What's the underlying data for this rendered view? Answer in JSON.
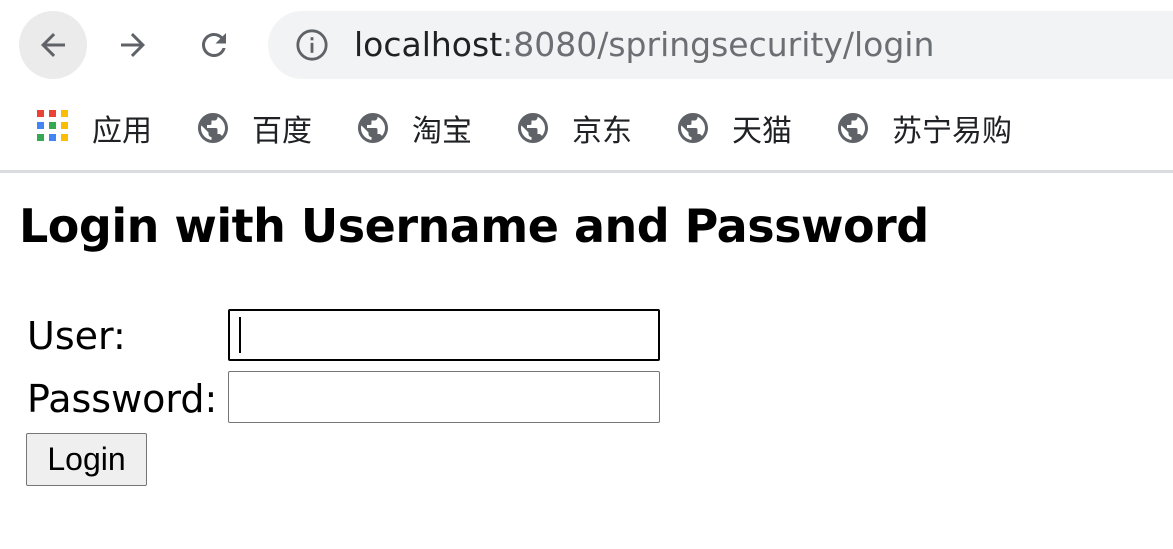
{
  "browser": {
    "url_host": "localhost",
    "url_path": ":8080/springsecurity/login",
    "icons": {
      "back": "arrow-left-icon",
      "forward": "arrow-right-icon",
      "reload": "reload-icon",
      "site_info": "info-icon"
    }
  },
  "bookmarks": [
    {
      "label": "应用",
      "icon": "apps-grid-icon"
    },
    {
      "label": "百度",
      "icon": "globe-icon"
    },
    {
      "label": "淘宝",
      "icon": "globe-icon"
    },
    {
      "label": "京东",
      "icon": "globe-icon"
    },
    {
      "label": "天猫",
      "icon": "globe-icon"
    },
    {
      "label": "苏宁易购",
      "icon": "globe-icon"
    }
  ],
  "page": {
    "heading": "Login with Username and Password",
    "user_label": "User:",
    "user_value": "",
    "password_label": "Password:",
    "password_value": "",
    "login_button": "Login"
  },
  "colors": {
    "omnibox_bg": "#f1f3f4",
    "url_path": "#6b6e72",
    "separator": "#dadce0",
    "button_bg": "#efefef"
  }
}
